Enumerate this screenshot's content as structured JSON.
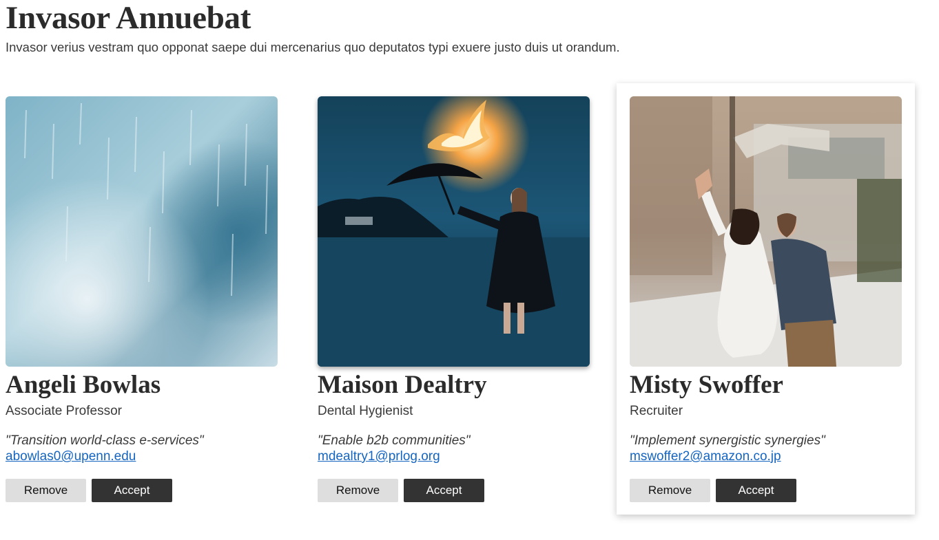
{
  "header": {
    "title": "Invasor Annuebat",
    "subtitle": "Invasor verius vestram quo opponat saepe dui mercenarius quo deputatos typi exuere justo duis ut orandum."
  },
  "cards": [
    {
      "name": "Angeli Bowlas",
      "role": "Associate Professor",
      "quote": "\"Transition world-class e-services\"",
      "email": "abowlas0@upenn.edu",
      "remove_label": "Remove",
      "accept_label": "Accept"
    },
    {
      "name": "Maison Dealtry",
      "role": "Dental Hygienist",
      "quote": "\"Enable b2b communities\"",
      "email": "mdealtry1@prlog.org",
      "remove_label": "Remove",
      "accept_label": "Accept"
    },
    {
      "name": "Misty Swoffer",
      "role": "Recruiter",
      "quote": "\"Implement synergistic synergies\"",
      "email": "mswoffer2@amazon.co.jp",
      "remove_label": "Remove",
      "accept_label": "Accept"
    }
  ],
  "colors": {
    "link": "#1565c0",
    "accept_button": "#333333",
    "remove_button": "#dedede"
  }
}
